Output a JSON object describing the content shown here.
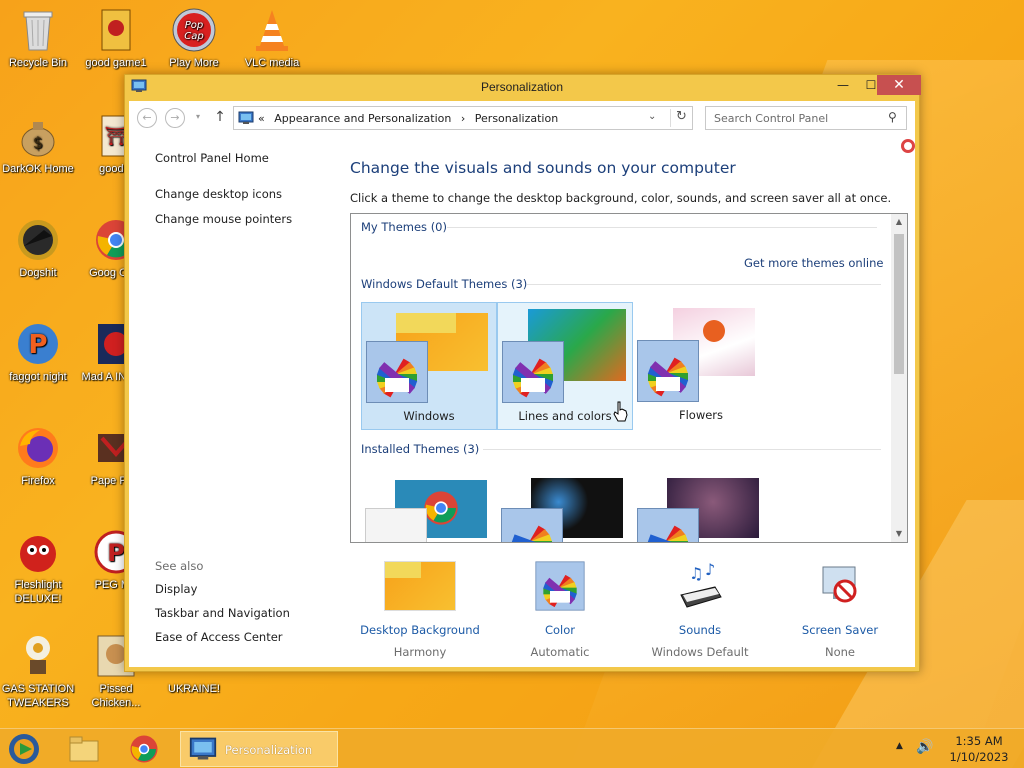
{
  "desktop": {
    "icons": [
      {
        "label": "Recycle Bin"
      },
      {
        "label": "good game1"
      },
      {
        "label": "Play More"
      },
      {
        "label": "VLC media"
      },
      {
        "label": "DarkOK Home"
      },
      {
        "label": "good g"
      },
      {
        "label": "Dogshit"
      },
      {
        "label": "Goog Chro"
      },
      {
        "label": "faggot night"
      },
      {
        "label": "Mad A IN SPA"
      },
      {
        "label": "Firefox"
      },
      {
        "label": "Pape Plea"
      },
      {
        "label": "Fleshlight DELUXE!"
      },
      {
        "label": "PEG MY"
      },
      {
        "label": "GAS STATION TWEAKERS"
      },
      {
        "label": "Pissed Chicken..."
      },
      {
        "label": "UKRAINE!"
      }
    ]
  },
  "window": {
    "title": "Personalization",
    "controls": {
      "minimize": "—",
      "maximize": "☐",
      "close": "✕"
    }
  },
  "toolbar": {
    "back": "←",
    "forward": "→",
    "recent": "▾",
    "up": "↑",
    "breadcrumb_prefix": "«",
    "breadcrumb": [
      "Appearance and Personalization",
      "›",
      "Personalization"
    ],
    "dropdown": "⌄",
    "refresh": "↻",
    "search_placeholder": "Search Control Panel",
    "search_icon": "⚲"
  },
  "left_nav": {
    "links": [
      "Control Panel Home",
      "Change desktop icons",
      "Change mouse pointers"
    ]
  },
  "see_also": {
    "heading": "See also",
    "links": [
      "Display",
      "Taskbar and Navigation",
      "Ease of Access Center"
    ]
  },
  "main": {
    "heading": "Change the visuals and sounds on your computer",
    "subheading": "Click a theme to change the desktop background, color, sounds, and screen saver all at once.",
    "groups": {
      "my_themes": "My Themes (0)",
      "get_more": "Get more themes online",
      "default_themes": "Windows Default Themes (3)",
      "installed_themes": "Installed Themes (3)"
    },
    "default_themes": [
      {
        "label": "Windows",
        "state": "selected"
      },
      {
        "label": "Lines and colors",
        "state": "hover"
      },
      {
        "label": "Flowers",
        "state": "normal"
      }
    ],
    "installed_themes": [
      {
        "label": ""
      },
      {
        "label": ""
      },
      {
        "label": ""
      }
    ],
    "scroll": {
      "up": "▲",
      "down": "▼"
    }
  },
  "bottom": {
    "items": [
      {
        "link": "Desktop Background",
        "value": "Harmony"
      },
      {
        "link": "Color",
        "value": "Automatic"
      },
      {
        "link": "Sounds",
        "value": "Windows Default"
      },
      {
        "link": "Screen Saver",
        "value": "None"
      }
    ]
  },
  "taskbar": {
    "active_app": "Personalization",
    "tray_arrow": "▲",
    "volume_icon": "🔊",
    "time": "1:35 AM",
    "date": "1/10/2023"
  },
  "colors": {
    "accent": "#f3c84a",
    "link": "#1c5aa6",
    "heading": "#1c3f7a",
    "close": "#c75050"
  }
}
